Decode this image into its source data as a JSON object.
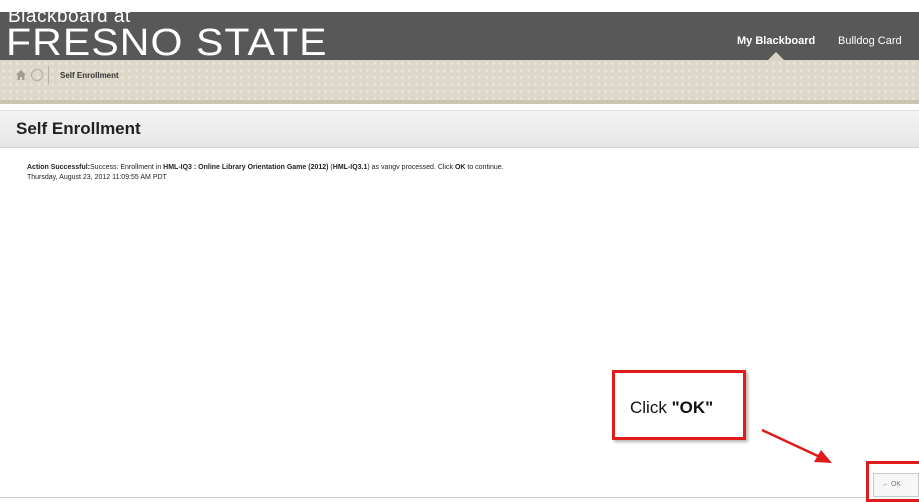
{
  "header": {
    "brand_small": "Blackboard at",
    "brand_big": "FRESNO STATE",
    "tabs": [
      {
        "label": "My Blackboard",
        "active": true
      },
      {
        "label": "Bulldog Card",
        "active": false
      }
    ]
  },
  "breadcrumb": {
    "current": "Self Enrollment"
  },
  "page": {
    "title": "Self Enrollment"
  },
  "receipt": {
    "status": "Action Successful:",
    "message_prefix": "Success: Enrollment in ",
    "course_name": "HML-IQ3 : Online Library Orientation Game (2012)",
    "course_id_open": " (",
    "course_id": "HML-IQ3.1",
    "message_mid": ") as vangv processed. Click ",
    "ok_word": "OK",
    "message_suffix": " to continue.",
    "timestamp": "Thursday, August 23, 2012 11:09:55 AM PDT"
  },
  "callout": {
    "prefix": "Click ",
    "emphasis": "\"OK\""
  },
  "ok_button": {
    "label": "← OK"
  },
  "colors": {
    "header_bg": "#585858",
    "callout_border": "#e01b1b"
  }
}
